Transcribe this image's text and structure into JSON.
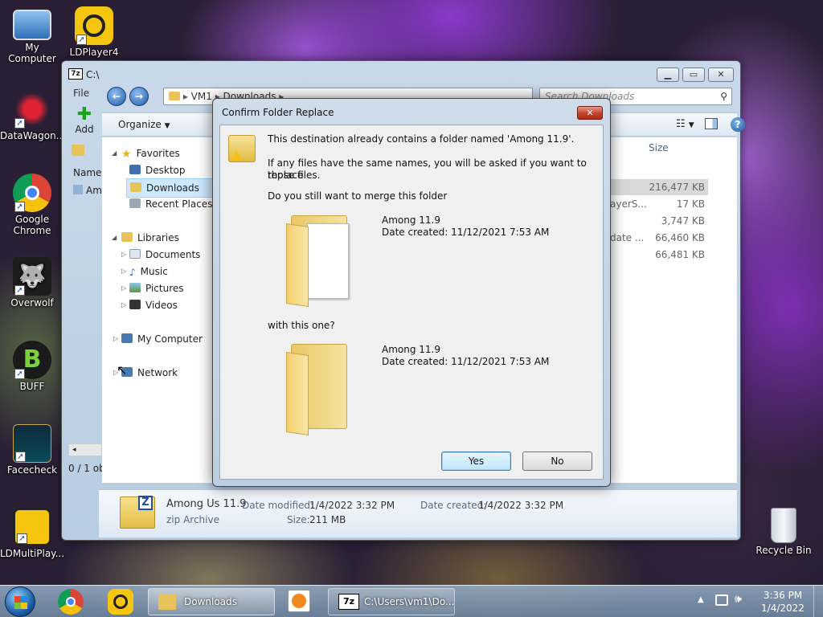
{
  "desktop": {
    "icons": [
      {
        "label": "My Computer",
        "icon": "computer-icon"
      },
      {
        "label": "LDPlayer4",
        "icon": "ldplayer-icon"
      },
      {
        "label": "DataWagon...",
        "icon": "datawagon-icon"
      },
      {
        "label": "Google Chrome",
        "icon": "chrome-icon"
      },
      {
        "label": "Overwolf",
        "icon": "overwolf-icon"
      },
      {
        "label": "BUFF",
        "icon": "buff-icon"
      },
      {
        "label": "Facecheck",
        "icon": "facecheck-icon"
      },
      {
        "label": "LDMultiPlay...",
        "icon": "ldmultiplayer-icon"
      },
      {
        "label": "Recycle Bin",
        "icon": "recycle-bin-icon"
      }
    ]
  },
  "explorer": {
    "title": "C:\\",
    "title_icon": "7z",
    "breadcrumb": [
      "VM1",
      "Downloads"
    ],
    "search_placeholder": "Search Downloads",
    "menu_file": "File",
    "toolbar_add": "Add",
    "organize": "Organize",
    "column_name": "Name",
    "column_size": "Size",
    "row_name_partial": "Am",
    "status_partial": "0 / 1 ob",
    "nav": {
      "favorites": "Favorites",
      "desktop": "Desktop",
      "downloads": "Downloads",
      "recent_places": "Recent Places",
      "libraries": "Libraries",
      "documents": "Documents",
      "music": "Music",
      "pictures": "Pictures",
      "videos": "Videos",
      "my_computer": "My Computer",
      "network": "Network"
    },
    "rows_partial": [
      {
        "type": "",
        "size": "216,477 KB"
      },
      {
        "type": "ayerS...",
        "size": "17 KB"
      },
      {
        "type": "",
        "size": "3,747 KB"
      },
      {
        "type": "date ...",
        "size": "66,460 KB"
      },
      {
        "type": "",
        "size": "66,481 KB"
      }
    ],
    "details": {
      "name": "Among Us 11.9",
      "type": "zip Archive",
      "modified_label": "Date modified:",
      "modified_value": "1/4/2022 3:32 PM",
      "created_label": "Date created:",
      "created_value": "1/4/2022 3:32 PM",
      "size_label": "Size:",
      "size_value": "211 MB"
    }
  },
  "dialog": {
    "title": "Confirm Folder Replace",
    "close": "✕",
    "line1": "This destination already contains a folder named 'Among 11.9'.",
    "line2a": "If any files have the same names, you will be asked if you want to replace",
    "line2b": "those files.",
    "line3": "Do you still want to merge this folder",
    "existing": {
      "name": "Among 11.9",
      "date": "Date created: 11/12/2021 7:53 AM"
    },
    "with_this": "with this one?",
    "incoming": {
      "name": "Among 11.9",
      "date": "Date created: 11/12/2021 7:53 AM"
    },
    "yes": "Yes",
    "no": "No"
  },
  "taskbar": {
    "items": [
      {
        "label": "Downloads",
        "icon": "folder-icon"
      },
      {
        "label": "C:\\Users\\vm1\\Do...",
        "icon": "7zip-icon"
      }
    ],
    "time": "3:36 PM",
    "date": "1/4/2022"
  }
}
